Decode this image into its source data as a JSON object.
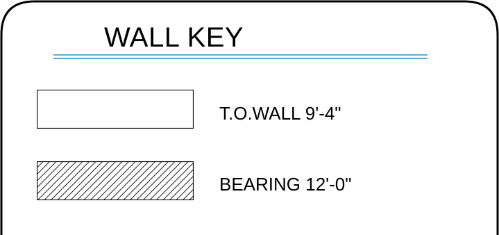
{
  "title": "WALL KEY",
  "accent_color": "#4fb3d9",
  "legend": [
    {
      "label": "T.O.WALL 9'-4\"",
      "pattern": "none"
    },
    {
      "label": "BEARING 12'-0\"",
      "pattern": "diagonal-hatch"
    }
  ]
}
